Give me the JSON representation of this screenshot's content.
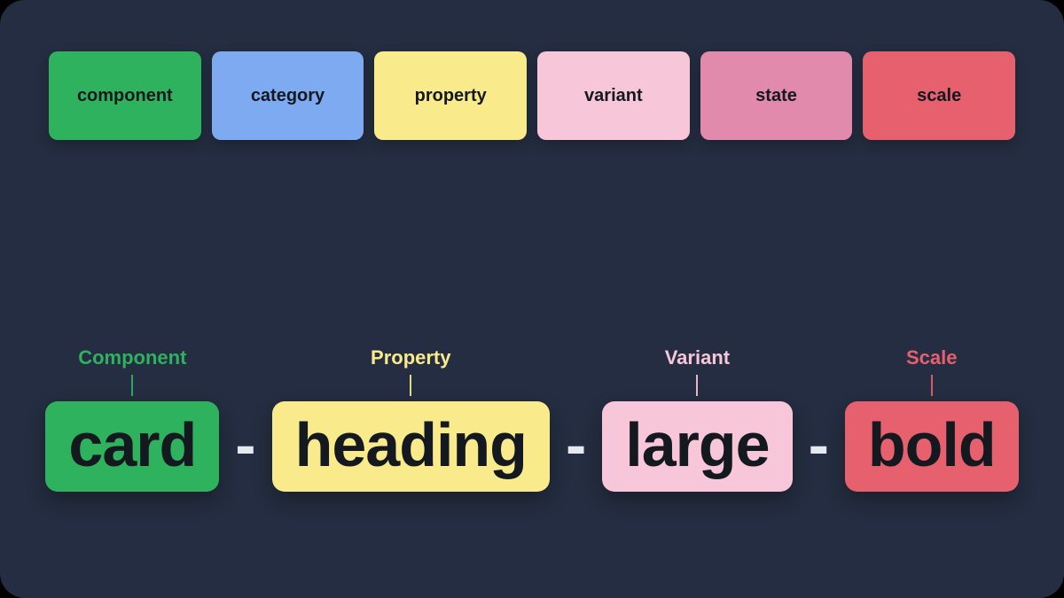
{
  "colors": {
    "green": "#2fb25e",
    "blue": "#7eaaf1",
    "yellow": "#f9ea8c",
    "lpink": "#f7c6d8",
    "mpink": "#e28aab",
    "red": "#e6606e"
  },
  "legend": [
    {
      "label": "component",
      "colorKey": "green"
    },
    {
      "label": "category",
      "colorKey": "blue"
    },
    {
      "label": "property",
      "colorKey": "yellow"
    },
    {
      "label": "variant",
      "colorKey": "lpink"
    },
    {
      "label": "state",
      "colorKey": "mpink"
    },
    {
      "label": "scale",
      "colorKey": "red"
    }
  ],
  "example": [
    {
      "caption": "Component",
      "value": "card",
      "colorKey": "green"
    },
    {
      "caption": "Property",
      "value": "heading",
      "colorKey": "yellow"
    },
    {
      "caption": "Variant",
      "value": "large",
      "colorKey": "lpink"
    },
    {
      "caption": "Scale",
      "value": "bold",
      "colorKey": "red"
    }
  ],
  "separator": "-"
}
